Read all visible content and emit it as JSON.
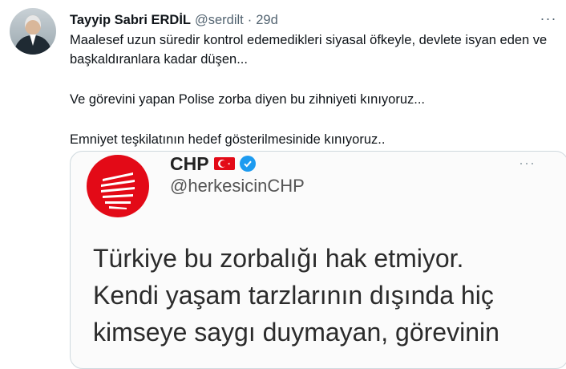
{
  "tweet": {
    "author_name": "Tayyip Sabri ERDİL",
    "author_handle": "@serdilt",
    "separator": "·",
    "time": "29d",
    "more_icon": "···",
    "paragraphs": [
      "Maalesef uzun süredir kontrol edemedikleri siyasal öfkeyle, devlete isyan eden ve başkaldıranlara kadar düşen...",
      "Ve görevini yapan Polise zorba diyen bu zihniyeti kınıyoruz...",
      "Emniyet teşkilatının hedef gösterilmesinide kınıyoruz.."
    ]
  },
  "embedded": {
    "account_name": "CHP",
    "account_handle": "@herkesicinCHP",
    "more_icon": "···",
    "lines": [
      "Türkiye bu zorbalığı hak etmiyor.",
      "Kendi yaşam tarzlarının dışında hiç",
      "kimseye saygı duymayan, görevinin"
    ],
    "brand_color": "#e30a17",
    "verified_color": "#1d9bf0"
  }
}
